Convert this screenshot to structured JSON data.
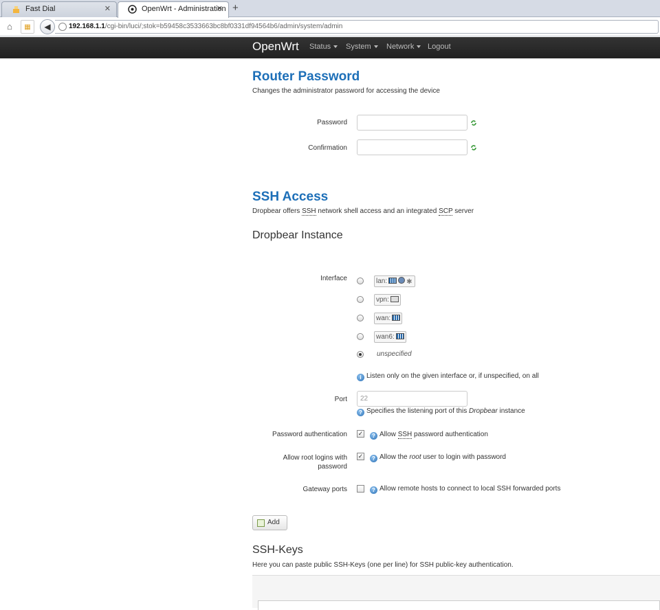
{
  "browser": {
    "tabs": [
      {
        "label": "Fast Dial",
        "active": false
      },
      {
        "label": "OpenWrt - Administration ...",
        "active": true
      }
    ],
    "new_tab_label": "+",
    "url_host": "192.168.1.1",
    "url_path": "/cgi-bin/luci/;stok=b59458c3533663bc8bf0331df94564b6/admin/system/admin"
  },
  "navbar": {
    "brand": "OpenWrt",
    "items": [
      "Status",
      "System",
      "Network",
      "Logout"
    ]
  },
  "router_password": {
    "title": "Router Password",
    "description": "Changes the administrator password for accessing the device",
    "password_label": "Password",
    "password_value": "",
    "confirmation_label": "Confirmation",
    "confirmation_value": ""
  },
  "ssh_access": {
    "title": "SSH Access",
    "desc_prefix": "Dropbear offers ",
    "desc_ssh": "SSH",
    "desc_middle": " network shell access and an integrated ",
    "desc_scp": "SCP",
    "desc_suffix": " server",
    "instance_title": "Dropbear Instance",
    "interface_label": "Interface",
    "interfaces": [
      {
        "label": "lan:",
        "selected": false
      },
      {
        "label": "vpn:",
        "selected": false
      },
      {
        "label": "wan:",
        "selected": false
      },
      {
        "label": "wan6:",
        "selected": false
      }
    ],
    "unspecified_label": "unspecified",
    "unspecified_selected": true,
    "interface_hint": "Listen only on the given interface or, if unspecified, on all",
    "port_label": "Port",
    "port_value": "22",
    "port_hint_prefix": "Specifies the listening port of this ",
    "port_hint_em": "Dropbear",
    "port_hint_suffix": " instance",
    "password_auth_label": "Password authentication",
    "password_auth_checked": true,
    "password_auth_hint_prefix": "Allow ",
    "password_auth_hint_abbr": "SSH",
    "password_auth_hint_suffix": " password authentication",
    "root_login_label_1": "Allow root logins with",
    "root_login_label_2": "password",
    "root_login_checked": true,
    "root_login_hint_prefix": "Allow the ",
    "root_login_hint_em": "root",
    "root_login_hint_suffix": " user to login with password",
    "gateway_ports_label": "Gateway ports",
    "gateway_ports_checked": false,
    "gateway_ports_hint": "Allow remote hosts to connect to local SSH forwarded ports",
    "add_button": "Add"
  },
  "ssh_keys": {
    "title": "SSH-Keys",
    "description": "Here you can paste public SSH-Keys (one per line) for SSH public-key authentication."
  },
  "colors": {
    "heading_blue": "#1d6fb8",
    "navbar_bg": "#222222"
  }
}
